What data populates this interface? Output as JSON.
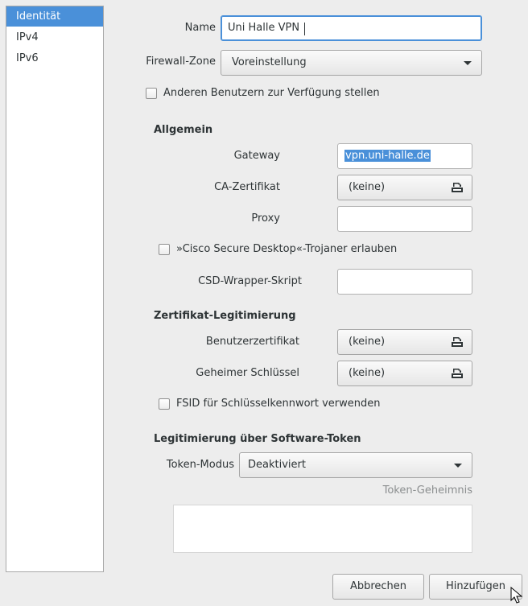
{
  "sidebar": {
    "items": [
      {
        "label": "Identität",
        "selected": true
      },
      {
        "label": "IPv4",
        "selected": false
      },
      {
        "label": "IPv6",
        "selected": false
      }
    ]
  },
  "identity": {
    "name_label": "Name",
    "name_value": "Uni Halle VPN",
    "firewall_label": "Firewall-Zone",
    "firewall_value": "Voreinstellung",
    "share_label": "Anderen Benutzern zur Verfügung stellen"
  },
  "general": {
    "heading": "Allgemein",
    "gateway_label": "Gateway",
    "gateway_value": "vpn.uni-halle.de",
    "ca_label": "CA-Zertifikat",
    "ca_value": "(keine)",
    "proxy_label": "Proxy",
    "proxy_value": "",
    "csd_check_label": "»Cisco Secure Desktop«-Trojaner erlauben",
    "csd_wrapper_label": "CSD-Wrapper-Skript",
    "csd_wrapper_value": ""
  },
  "cert_auth": {
    "heading": "Zertifikat-Legitimierung",
    "user_cert_label": "Benutzerzertifikat",
    "user_cert_value": "(keine)",
    "private_key_label": "Geheimer Schlüssel",
    "private_key_value": "(keine)",
    "fsid_label": "FSID für Schlüsselkennwort verwenden"
  },
  "token_auth": {
    "heading": "Legitimierung über Software-Token",
    "mode_label": "Token-Modus",
    "mode_value": "Deaktiviert",
    "secret_label": "Token-Geheimnis",
    "secret_value": ""
  },
  "buttons": {
    "cancel": "Abbrechen",
    "add": "Hinzufügen"
  },
  "colors": {
    "accent": "#4a90d9",
    "background": "#ededed"
  }
}
